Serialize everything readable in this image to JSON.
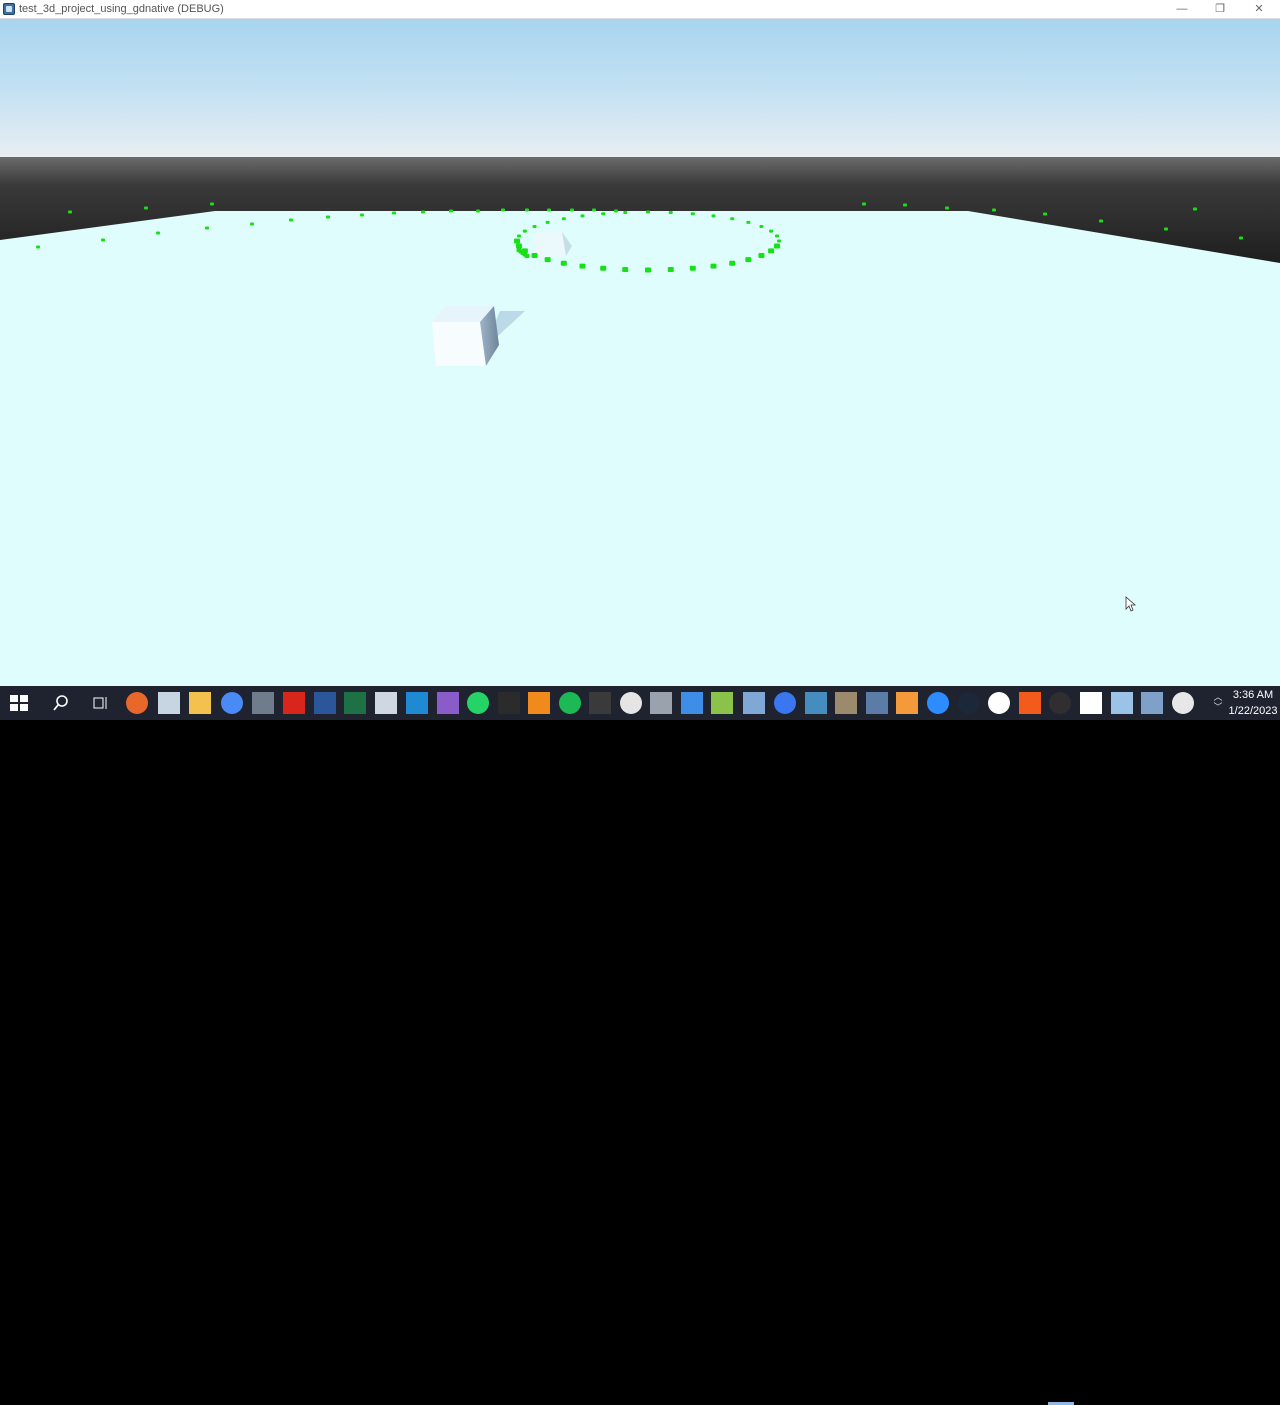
{
  "window": {
    "title": "test_3d_project_using_gdnative (DEBUG)",
    "minimize_glyph": "—",
    "maximize_glyph": "❐",
    "close_glyph": "✕"
  },
  "scene": {
    "sky_top_color": "#a9d5f0",
    "sky_horizon_color": "#e8eef2",
    "ground_color": "#dffdfd",
    "marker_color": "#18e018",
    "cube_color": "#f7fdff"
  },
  "taskbar": {
    "icons": [
      "windows-start-icon",
      "search-icon",
      "task-view-icon",
      "firefox-icon",
      "file-explorer-alt-icon",
      "file-explorer-icon",
      "chrome-icon",
      "calculator-icon",
      "acrobat-icon",
      "word-icon",
      "excel-icon",
      "snipping-tool-icon",
      "vscode-icon",
      "visual-studio-icon",
      "whatsapp-icon",
      "terminal-icon",
      "vlc-icon",
      "spotify-icon",
      "terminal-alt-icon",
      "slack-icon",
      "generic-app-icon",
      "todo-icon",
      "notepad-plus-icon",
      "network-icon",
      "signal-icon",
      "godot-icon",
      "gimp-icon",
      "remote-desktop-icon",
      "notes-icon",
      "zoom-icon",
      "steam-icon",
      "github-icon",
      "orange-app-icon",
      "obs-icon",
      "document-icon",
      "paint-icon",
      "virtualbox-icon",
      "clock-app-icon"
    ],
    "tray_chevron": "︿\n﹀",
    "time": "3:36 AM",
    "date": "1/22/2023"
  }
}
